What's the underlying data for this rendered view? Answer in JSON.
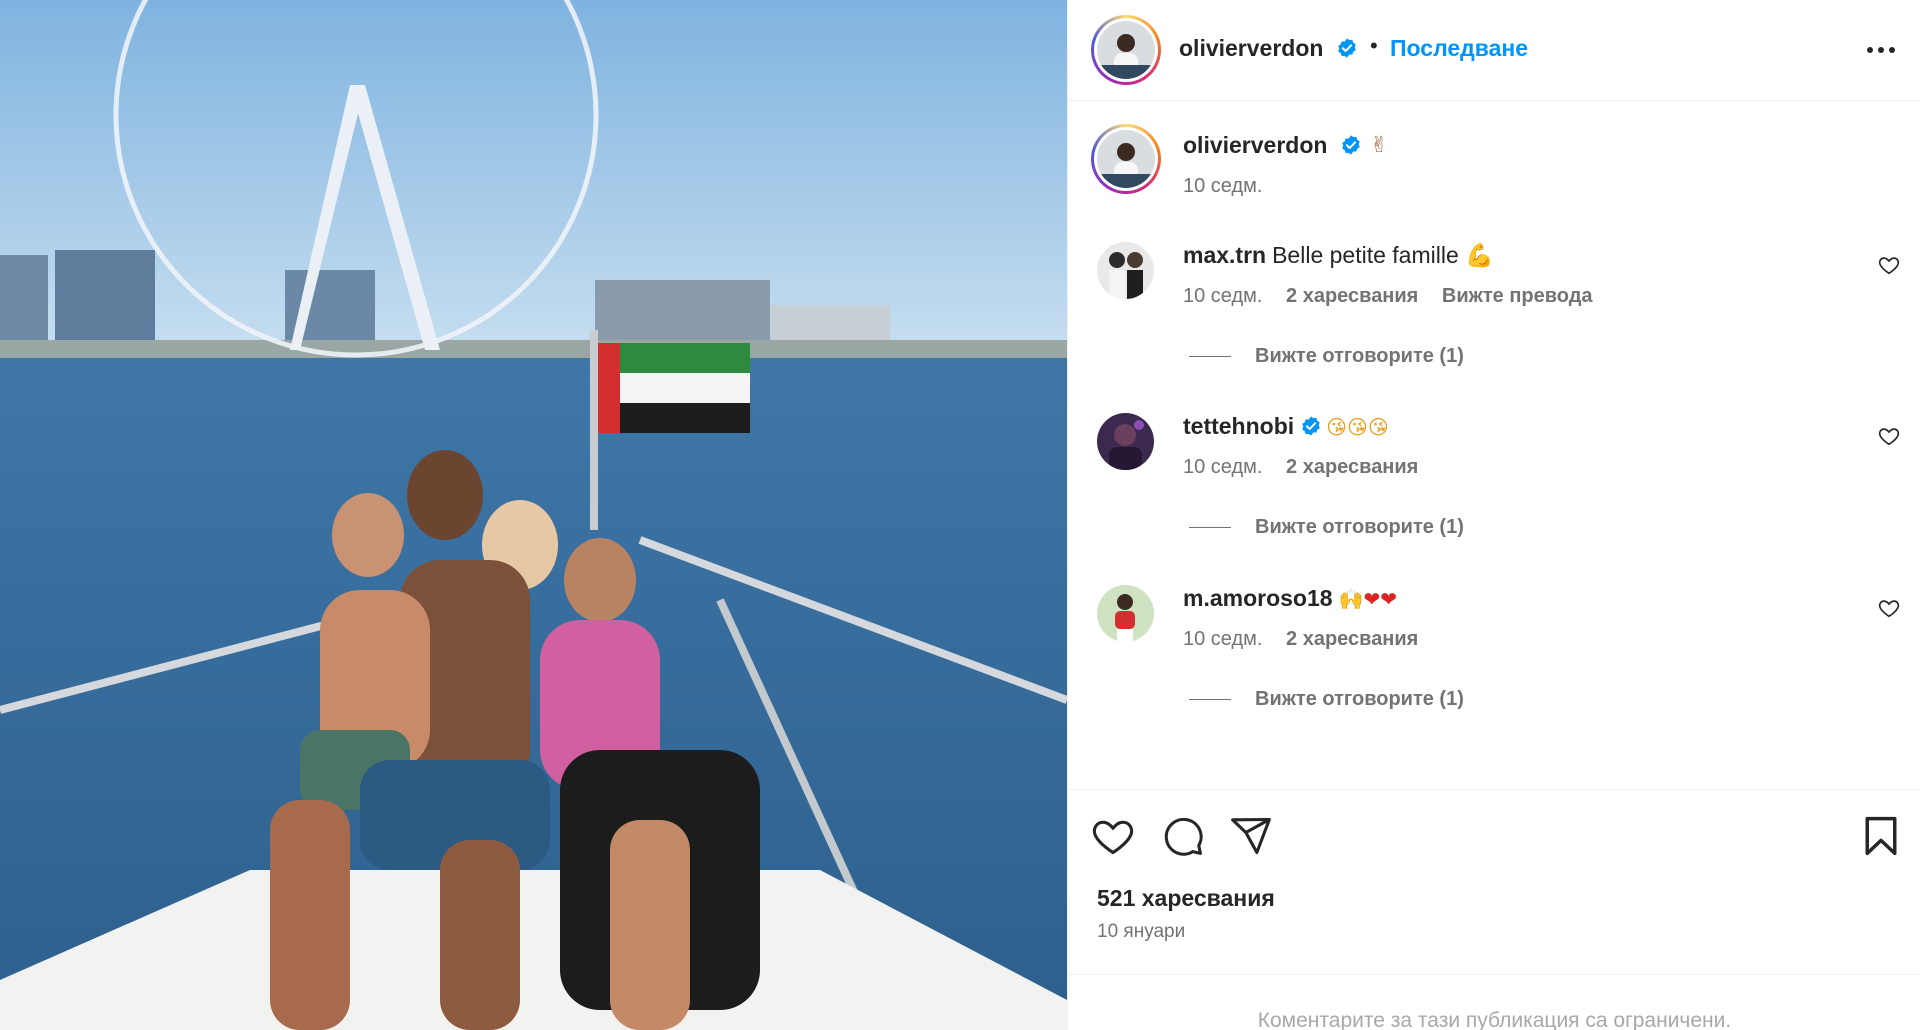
{
  "post": {
    "author": "olivierverdon",
    "follow_label": "Последване",
    "separator": "•",
    "caption_emoji": "✌",
    "caption_time": "10 седм."
  },
  "comments": [
    {
      "username": "max.trn",
      "text": "Belle petite famille 💪",
      "time": "10 седм.",
      "likes": "2 харесвания",
      "translate": "Вижте превода",
      "replies": "Вижте отговорите (1)",
      "verified": false
    },
    {
      "username": "tettehnobi",
      "text": "😘😘😘",
      "time": "10 седм.",
      "likes": "2 харесвания",
      "replies": "Вижте отговорите (1)",
      "verified": true
    },
    {
      "username": "m.amoroso18",
      "text": "🙌❤❤",
      "time": "10 седм.",
      "likes": "2 харесвания",
      "replies": "Вижте отговорите (1)",
      "verified": false
    }
  ],
  "actions": {
    "likes_count": "521 харесвания",
    "date": "10 януари"
  },
  "footer": {
    "restricted_notice": "Коментарите за тази публикация са ограничени."
  },
  "icons": {
    "like": "heart-icon",
    "comment": "comment-icon",
    "share": "send-icon",
    "save": "bookmark-icon",
    "more": "more-options-icon",
    "verified": "verified-badge-icon"
  },
  "colors": {
    "link": "#0095f6",
    "verified": "#0095f6",
    "secondary_text": "#737373"
  }
}
